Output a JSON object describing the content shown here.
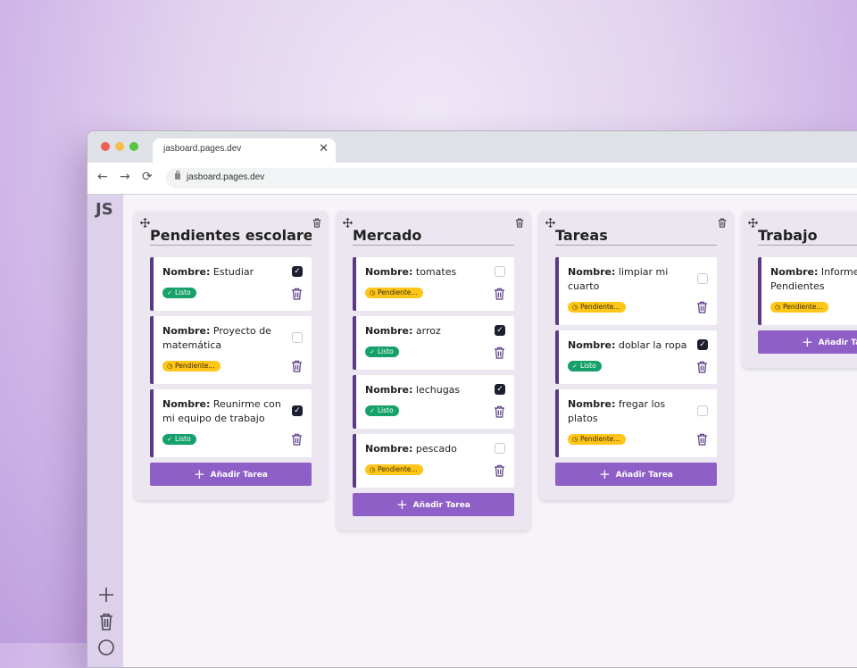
{
  "browser": {
    "tab_title": "jasboard.pages.dev",
    "url": "jasboard.pages.dev",
    "tab_close": "✕",
    "back": "←",
    "forward": "→",
    "reload": "⟳"
  },
  "app": {
    "logo": "JS",
    "sidebar_icons": [
      "plus-icon",
      "trash-icon",
      "help-icon"
    ]
  },
  "labels": {
    "name_prefix": "Nombre:",
    "add_task": "Añadir Tarea",
    "status_done": "Listo",
    "status_pending": "Pendiente..."
  },
  "colors": {
    "accent": "#8e5fc6",
    "card_border": "#5a3a85",
    "done": "#16a06a",
    "pending": "#ffc61a",
    "sidebar": "#ddd0ea"
  },
  "columns": [
    {
      "title": "Pendientes escolares",
      "tasks": [
        {
          "name": "Estudiar",
          "checked": true,
          "status": "Listo"
        },
        {
          "name": "Proyecto de matemática",
          "checked": false,
          "status": "Pendiente..."
        },
        {
          "name": "Reunirme con mi equipo de trabajo",
          "checked": true,
          "status": "Listo"
        }
      ]
    },
    {
      "title": "Mercado",
      "tasks": [
        {
          "name": "tomates",
          "checked": false,
          "status": "Pendiente..."
        },
        {
          "name": "arroz",
          "checked": true,
          "status": "Listo"
        },
        {
          "name": "lechugas",
          "checked": true,
          "status": "Listo"
        },
        {
          "name": "pescado",
          "checked": false,
          "status": "Pendiente..."
        }
      ]
    },
    {
      "title": "Tareas",
      "tasks": [
        {
          "name": "limpiar mi cuarto",
          "checked": false,
          "status": "Pendiente..."
        },
        {
          "name": "doblar la ropa",
          "checked": true,
          "status": "Listo"
        },
        {
          "name": "fregar los platos",
          "checked": false,
          "status": "Pendiente..."
        }
      ]
    },
    {
      "title": "Trabajo",
      "tasks": [
        {
          "name": "Informes Pendientes",
          "checked": false,
          "status": "Pendiente..."
        }
      ]
    }
  ]
}
